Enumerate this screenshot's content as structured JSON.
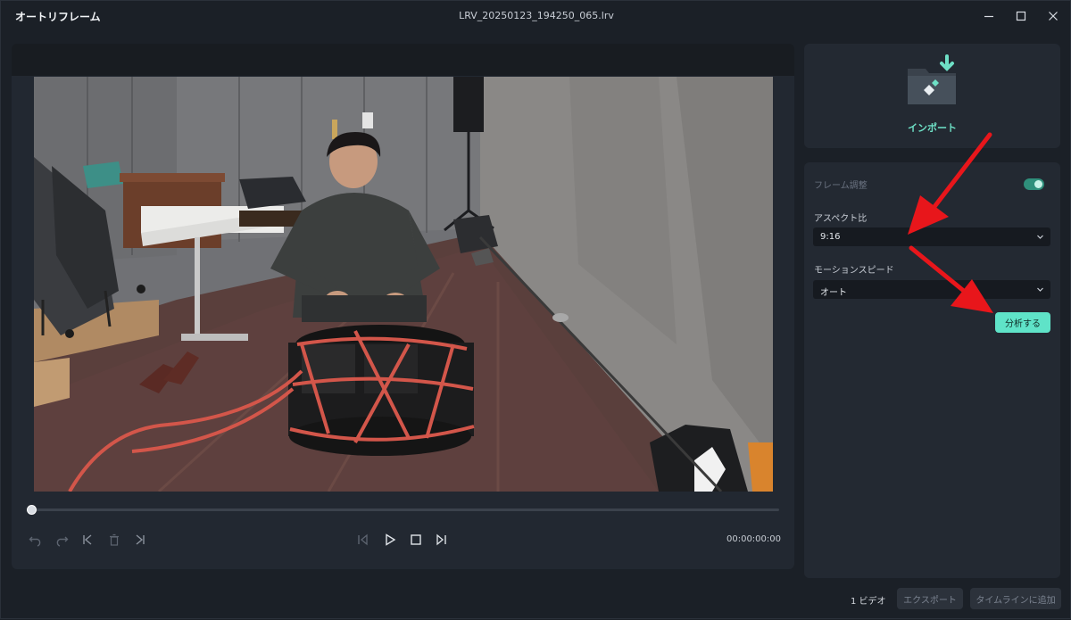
{
  "titlebar": {
    "app_title": "オートリフレーム",
    "file_name": "LRV_20250123_194250_065.lrv"
  },
  "player": {
    "timecode": "00:00:00:00",
    "playback_progress": 0
  },
  "import": {
    "label": "インポート"
  },
  "settings": {
    "frame_adjust_label": "フレーム調整",
    "frame_adjust_on": true,
    "aspect_label": "アスペクト比",
    "aspect_value": "9:16",
    "motion_label": "モーションスピード",
    "motion_value": "オート",
    "analyze_label": "分析する"
  },
  "footer": {
    "video_count": "1 ビデオ",
    "export_label": "エクスポート",
    "add_timeline_label": "タイムラインに追加"
  },
  "colors": {
    "accent": "#5fe3c8",
    "annotation_arrow": "#e8161b",
    "background": "#1b2027",
    "panel": "#232932"
  }
}
